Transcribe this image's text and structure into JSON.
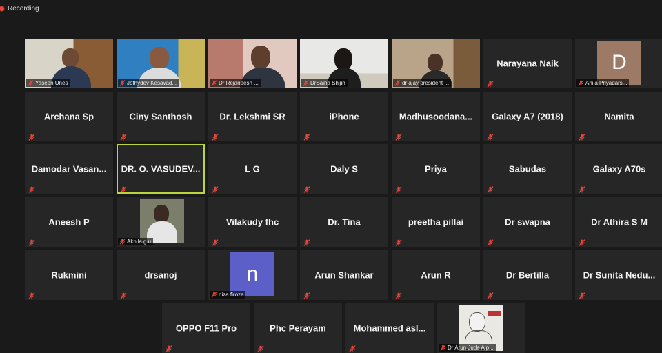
{
  "recording": {
    "label": "Recording"
  },
  "participants": [
    {
      "name": "Yaseen Unes",
      "tile_type": "video"
    },
    {
      "name": "Jothydev Kesavad...",
      "tile_type": "video"
    },
    {
      "name": "Dr Rejaneesh ...",
      "tile_type": "video"
    },
    {
      "name": "DrSajna Shijin",
      "tile_type": "video"
    },
    {
      "name": "dr ajay president ...",
      "tile_type": "video"
    },
    {
      "name": "Narayana Naik",
      "tile_type": "name"
    },
    {
      "name": "Ahila Priyadars...",
      "tile_type": "avatar",
      "avatar_letter": "D",
      "avatar_color": "#9c7a66"
    },
    {
      "name": "Archana Sp",
      "tile_type": "name"
    },
    {
      "name": "Ciny Santhosh",
      "tile_type": "name"
    },
    {
      "name": "Dr. Lekshmi SR",
      "tile_type": "name"
    },
    {
      "name": "iPhone",
      "tile_type": "name"
    },
    {
      "name": "Madhusoodana...",
      "tile_type": "name"
    },
    {
      "name": "Galaxy A7 (2018)",
      "tile_type": "name"
    },
    {
      "name": "Namita",
      "tile_type": "name"
    },
    {
      "name": "Damodar Vasan...",
      "tile_type": "name"
    },
    {
      "name": "DR. O. VASUDEV...",
      "tile_type": "name",
      "active_speaker": true
    },
    {
      "name": "L G",
      "tile_type": "name"
    },
    {
      "name": "Daly S",
      "tile_type": "name"
    },
    {
      "name": "Priya",
      "tile_type": "name"
    },
    {
      "name": "Sabudas",
      "tile_type": "name"
    },
    {
      "name": "Galaxy A70s",
      "tile_type": "name"
    },
    {
      "name": "Aneesh P",
      "tile_type": "name"
    },
    {
      "name": "Akhila g u",
      "tile_type": "photo"
    },
    {
      "name": "Vilakudy fhc",
      "tile_type": "name"
    },
    {
      "name": "Dr. Tina",
      "tile_type": "name"
    },
    {
      "name": "preetha pillai",
      "tile_type": "name"
    },
    {
      "name": "Dr swapna",
      "tile_type": "name"
    },
    {
      "name": "Dr Athira S M",
      "tile_type": "name"
    },
    {
      "name": "Rukmini",
      "tile_type": "name"
    },
    {
      "name": "drsanoj",
      "tile_type": "name"
    },
    {
      "name": "niza firoze",
      "tile_type": "avatar",
      "avatar_letter": "n",
      "avatar_color": "#5b5fc7"
    },
    {
      "name": "Arun Shankar",
      "tile_type": "name"
    },
    {
      "name": "Arun R",
      "tile_type": "name"
    },
    {
      "name": "Dr Bertilla",
      "tile_type": "name"
    },
    {
      "name": "Dr Sunita Nedu...",
      "tile_type": "name"
    },
    {
      "name": "OPPO F11 Pro",
      "tile_type": "name"
    },
    {
      "name": "Phc Perayam",
      "tile_type": "name"
    },
    {
      "name": "Mohammed asl...",
      "tile_type": "name"
    },
    {
      "name": "Dr Arun Jude Alp...",
      "tile_type": "photo"
    }
  ],
  "icons": {
    "mute": "mic-off-icon",
    "recording": "record-dot-icon"
  },
  "colors": {
    "active_border": "#b9d63a",
    "mute_icon": "#e0473c",
    "tile_bg": "#262626"
  }
}
